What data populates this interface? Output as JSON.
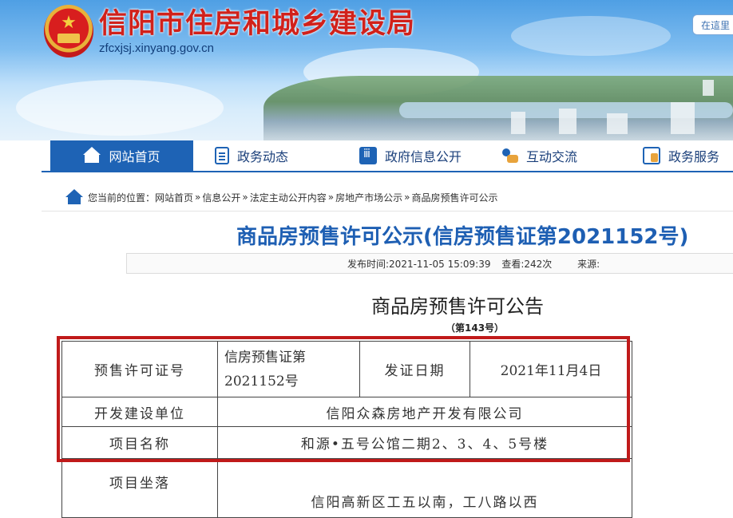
{
  "header": {
    "site_title": "信阳市住房和城乡建设局",
    "site_url": "zfcxjsj.xinyang.gov.cn",
    "external_button": "在這里"
  },
  "nav": {
    "items": [
      {
        "label": "网站首页",
        "icon": "home-icon",
        "active": true
      },
      {
        "label": "政务动态",
        "icon": "document-icon",
        "active": false
      },
      {
        "label": "政府信息公开",
        "icon": "info-public-icon",
        "active": false
      },
      {
        "label": "互动交流",
        "icon": "chat-users-icon",
        "active": false
      },
      {
        "label": "政务服务",
        "icon": "service-icon",
        "active": false
      }
    ]
  },
  "breadcrumb": {
    "prefix": "您当前的位置：",
    "items": [
      "网站首页",
      "信息公开",
      "法定主动公开内容",
      "房地产市场公示",
      "商品房预售许可公示"
    ],
    "separator": "»"
  },
  "article": {
    "title": "商品房预售许可公示(信房预售证第2021152号)",
    "publish_time": "发布时间:2021-11-05 15:09:39",
    "views": "查看:242次",
    "source": "来源:"
  },
  "notice": {
    "title": "商品房预售许可公告",
    "number": "（第143号）",
    "table": {
      "permit_label": "预售许可证号",
      "permit_value": "信房预售证第2021152号",
      "permit_value_line1": "信房预售证第",
      "permit_value_line2": "2021152号",
      "issue_date_label": "发证日期",
      "issue_date_value": "2021年11月4日",
      "developer_label": "开发建设单位",
      "developer_value": "信阳众森房地产开发有限公司",
      "project_label": "项目名称",
      "project_value": "和源•五号公馆二期2、3、4、5号楼",
      "location_label": "项目坐落",
      "location_value": "信阳高新区工五以南，工八路以西"
    }
  },
  "colors": {
    "accent": "#1e63b5",
    "title_red": "#d1211b",
    "highlight_red": "#c01a1a"
  }
}
